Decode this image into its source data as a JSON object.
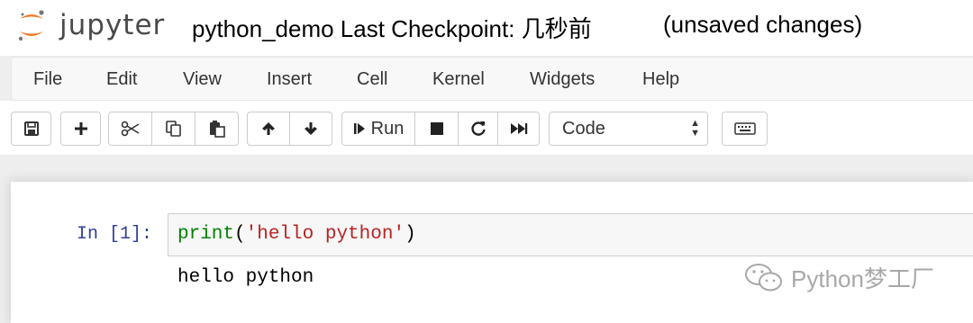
{
  "header": {
    "logo_text": "jupyter",
    "notebook_name": "python_demo",
    "checkpoint": "Last Checkpoint: 几秒前",
    "save_status": "(unsaved changes)"
  },
  "menubar": {
    "items": [
      "File",
      "Edit",
      "View",
      "Insert",
      "Cell",
      "Kernel",
      "Widgets",
      "Help"
    ]
  },
  "toolbar": {
    "run_label": "Run",
    "cell_type": "Code",
    "icons": [
      "save-icon",
      "plus-icon",
      "cut-icon",
      "copy-icon",
      "paste-icon",
      "arrow-up-icon",
      "arrow-down-icon",
      "step-forward-icon",
      "stop-icon",
      "restart-icon",
      "fast-forward-icon",
      "keyboard-icon"
    ]
  },
  "cell": {
    "prompt": "In [1]:",
    "code_fn": "print",
    "code_open": "(",
    "code_string": "'hello python'",
    "code_close": ")",
    "output": "hello python"
  },
  "watermark": {
    "text": "Python梦工厂"
  },
  "colors": {
    "logo_orange": "#f37726",
    "prompt_blue": "#303f9f",
    "code_builtin": "#008000",
    "code_string": "#ba2121"
  }
}
